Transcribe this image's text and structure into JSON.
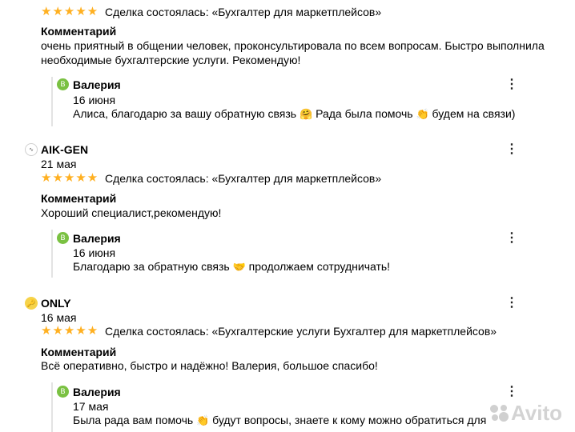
{
  "review1": {
    "stars": "★★★★★",
    "deal": "Сделка состоялась: «Бухгалтер для маркетплейсов»",
    "comment_title": "Комментарий",
    "comment_line1": "очень приятный в общении человек, проконсультировала по всем вопросам. Быстро выполнила",
    "comment_line2": "необходимые бухгалтерские услуги. Рекомендую!",
    "reply": {
      "avatar_letter": "В",
      "author": "Валерия",
      "date": "16 июня",
      "text_a": "Алиса, благодарю за вашу обратную связь",
      "emoji_a": "🤗",
      "text_b": "Рада была помочь",
      "emoji_b": "👏",
      "text_c": "будем на связи)"
    }
  },
  "review2": {
    "avatar_text": "∿",
    "author": "AIK-GEN",
    "date": "21 мая",
    "stars": "★★★★★",
    "deal": "Сделка состоялась: «Бухгалтер для маркетплейсов»",
    "comment_title": "Комментарий",
    "comment_text": "Хороший специалист,рекомендую!",
    "reply": {
      "avatar_letter": "В",
      "author": "Валерия",
      "date": "16 июня",
      "text_a": "Благодарю за обратную связь",
      "emoji_a": "🤝",
      "text_b": "продолжаем сотрудничать!"
    }
  },
  "review3": {
    "avatar_text": "🔑",
    "author": "ONLY",
    "date": "16 мая",
    "stars": "★★★★★",
    "deal": "Сделка состоялась: «Бухгалтерские услуги Бухгалтер для маркетплейсов»",
    "comment_title": "Комментарий",
    "comment_text": "Всё оперативно, быстро и надёжно! Валерия, большое спасибо!",
    "reply": {
      "avatar_letter": "В",
      "author": "Валерия",
      "date": "17 мая",
      "text_a": "Была рада вам помочь",
      "emoji_a": "👏",
      "text_b": "будут вопросы, знаете к кому можно обратиться для"
    }
  },
  "menu_glyph": "⋮",
  "watermark": "Avito",
  "colors": {
    "stars": "#ffb021",
    "avatar_green": "#7ac142",
    "avatar_yellow": "#f6d34a"
  }
}
